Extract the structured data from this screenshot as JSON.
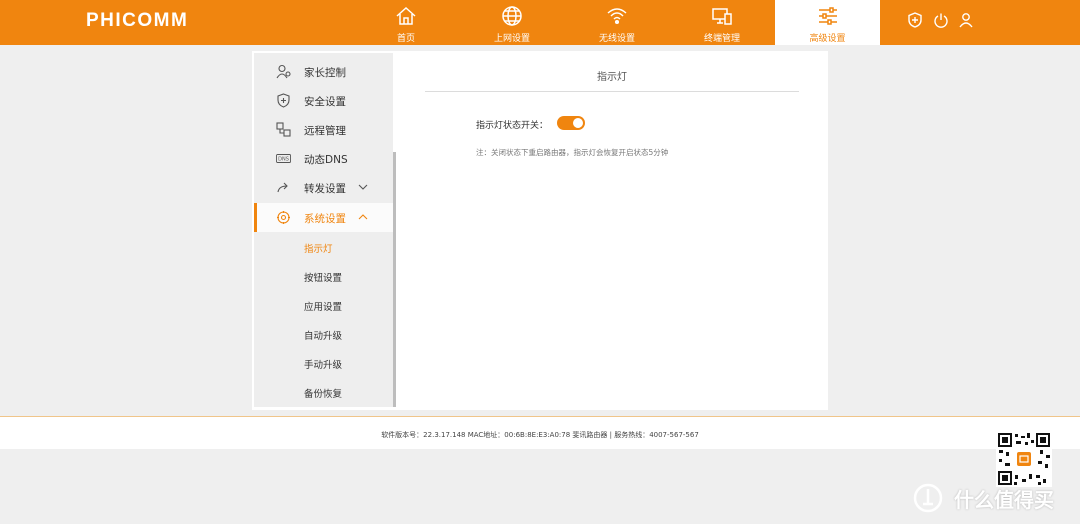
{
  "brand": {
    "logo": "PHICOMM",
    "accent": "#f0850f"
  },
  "nav": [
    {
      "label": "首页",
      "icon": "home-icon"
    },
    {
      "label": "上网设置",
      "icon": "globe-icon"
    },
    {
      "label": "无线设置",
      "icon": "wifi-icon"
    },
    {
      "label": "终端管理",
      "icon": "devices-icon"
    },
    {
      "label": "高级设置",
      "icon": "sliders-icon",
      "active": true
    }
  ],
  "toolbar": {
    "icons": [
      "shield-plus-icon",
      "power-icon",
      "user-icon"
    ]
  },
  "sidebar": {
    "items": [
      {
        "label": "家长控制",
        "icon": "parent-icon"
      },
      {
        "label": "安全设置",
        "icon": "shield-icon"
      },
      {
        "label": "远程管理",
        "icon": "remote-icon"
      },
      {
        "label": "动态DNS",
        "icon": "dns-icon"
      },
      {
        "label": "转发设置",
        "icon": "forward-icon",
        "expand": "chevron-down-icon"
      },
      {
        "label": "系统设置",
        "icon": "system-icon",
        "expand": "chevron-up-icon",
        "active": true
      }
    ],
    "subitems": [
      {
        "label": "指示灯",
        "active": true
      },
      {
        "label": "按钮设置"
      },
      {
        "label": "应用设置"
      },
      {
        "label": "自动升级"
      },
      {
        "label": "手动升级"
      },
      {
        "label": "备份恢复"
      }
    ]
  },
  "panel": {
    "title": "指示灯",
    "switch_label": "指示灯状态开关：",
    "switch_on": true,
    "note": "注：关闭状态下重启路由器，指示灯会恢复开启状态5分钟"
  },
  "footer": {
    "text": "软件版本号：22.3.17.148    MAC地址：00:6B:8E:E3:A0:78    斐讯路由器 | 服务热线：4007-567-567"
  },
  "watermark": {
    "text": "什么值得买",
    "icon": "smzdm-icon"
  }
}
